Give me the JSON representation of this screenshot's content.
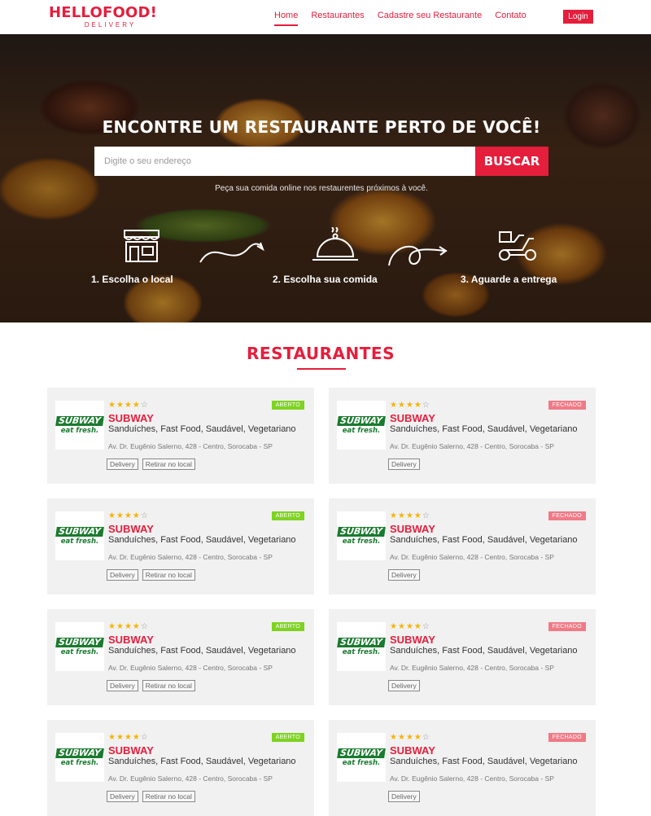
{
  "header": {
    "logo_main": "HELLOFOOD!",
    "logo_sub": "DELIVERY",
    "nav": [
      "Home",
      "Restaurantes",
      "Cadastre seu Restaurante",
      "Contato"
    ],
    "login": "Login"
  },
  "hero": {
    "title": "ENCONTRE UM RESTAURANTE PERTO DE VOCÊ!",
    "search_placeholder": "Digite o seu endereço",
    "search_button": "BUSCAR",
    "subtitle": "Peça sua comida online nos restaurentes próximos à você.",
    "steps": [
      "1. Escolha o local",
      "2. Escolha sua comida",
      "3. Aguarde a entrega"
    ]
  },
  "restaurants": {
    "title": "RESTAURANTES",
    "logo_text": "SUBWAY",
    "logo_tagline": "eat fresh.",
    "items": [
      {
        "name": "SUBWAY",
        "rating": 4,
        "status": "ABERTO",
        "categories": "Sanduíches, Fast Food, Saudável, Vegetariano",
        "address": "Av. Dr. Eugênio Salerno, 428 - Centro, Sorocaba - SP",
        "tags": [
          "Delivery",
          "Retirar no local"
        ]
      },
      {
        "name": "SUBWAY",
        "rating": 4,
        "status": "FECHADO",
        "categories": "Sanduíches, Fast Food, Saudável, Vegetariano",
        "address": "Av. Dr. Eugênio Salerno, 428 - Centro, Sorocaba - SP",
        "tags": [
          "Delivery"
        ]
      },
      {
        "name": "SUBWAY",
        "rating": 4,
        "status": "ABERTO",
        "categories": "Sanduíches, Fast Food, Saudável, Vegetariano",
        "address": "Av. Dr. Eugênio Salerno, 428 - Centro, Sorocaba - SP",
        "tags": [
          "Delivery",
          "Retirar no local"
        ]
      },
      {
        "name": "SUBWAY",
        "rating": 4,
        "status": "FECHADO",
        "categories": "Sanduíches, Fast Food, Saudável, Vegetariano",
        "address": "Av. Dr. Eugênio Salerno, 428 - Centro, Sorocaba - SP",
        "tags": [
          "Delivery"
        ]
      },
      {
        "name": "SUBWAY",
        "rating": 4,
        "status": "ABERTO",
        "categories": "Sanduíches, Fast Food, Saudável, Vegetariano",
        "address": "Av. Dr. Eugênio Salerno, 428 - Centro, Sorocaba - SP",
        "tags": [
          "Delivery",
          "Retirar no local"
        ]
      },
      {
        "name": "SUBWAY",
        "rating": 4,
        "status": "FECHADO",
        "categories": "Sanduíches, Fast Food, Saudável, Vegetariano",
        "address": "Av. Dr. Eugênio Salerno, 428 - Centro, Sorocaba - SP",
        "tags": [
          "Delivery"
        ]
      },
      {
        "name": "SUBWAY",
        "rating": 4,
        "status": "ABERTO",
        "categories": "Sanduíches, Fast Food, Saudável, Vegetariano",
        "address": "Av. Dr. Eugênio Salerno, 428 - Centro, Sorocaba - SP",
        "tags": [
          "Delivery",
          "Retirar no local"
        ]
      },
      {
        "name": "SUBWAY",
        "rating": 4,
        "status": "FECHADO",
        "categories": "Sanduíches, Fast Food, Saudável, Vegetariano",
        "address": "Av. Dr. Eugênio Salerno, 428 - Centro, Sorocaba - SP",
        "tags": [
          "Delivery"
        ]
      }
    ]
  },
  "colors": {
    "brand": "#e51e3c",
    "open": "#7ed321",
    "closed": "#f07a86",
    "star": "#f5b400"
  },
  "icons": [
    "store-icon",
    "curved-arrow-icon",
    "cloche-icon",
    "loop-arrow-icon",
    "delivery-scooter-icon"
  ]
}
